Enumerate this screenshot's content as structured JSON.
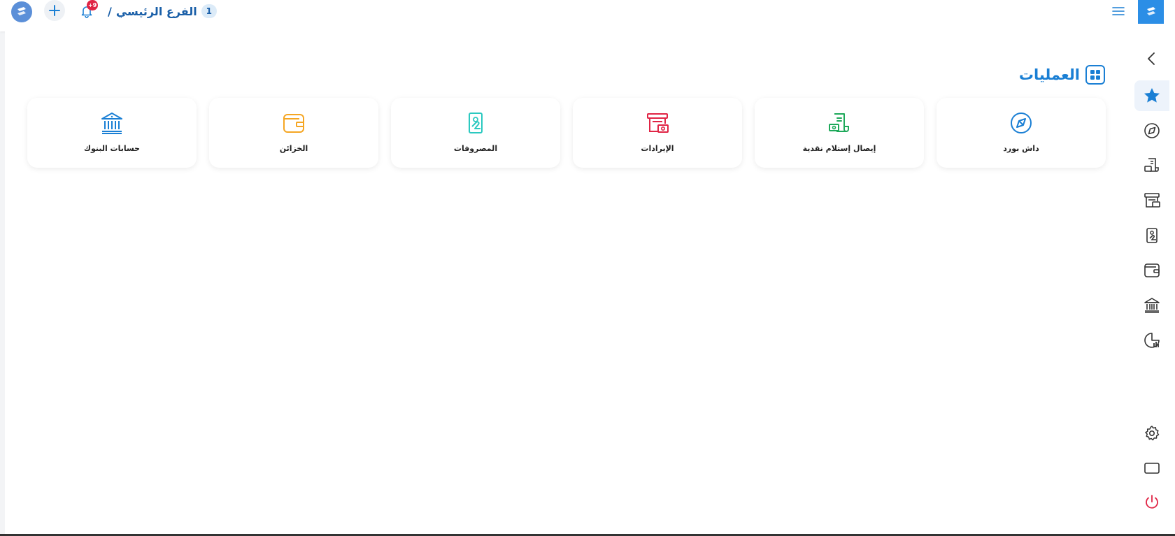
{
  "header": {
    "breadcrumb_branch": "الفرع الرئيسي",
    "breadcrumb_separator": "/",
    "branch_number": "1",
    "notification_badge": "+9",
    "logo_icon": "brand-logo-icon",
    "add_icon": "plus-icon",
    "bell_icon": "bell-icon",
    "menu_icon": "hamburger-menu-icon"
  },
  "section": {
    "title": "العمليات",
    "icon": "grid-icon",
    "accent": "#1a7fd4"
  },
  "cards": [
    {
      "label": "داش بورد",
      "icon": "compass-icon",
      "color": "#1a7fd4"
    },
    {
      "label": "إيصال إستلام نقدية",
      "icon": "cash-receipt-icon",
      "color": "#1ea95a"
    },
    {
      "label": "الإيرادات",
      "icon": "revenue-register-icon",
      "color": "#e02445"
    },
    {
      "label": "المصروفات",
      "icon": "expense-hand-money-icon",
      "color": "#2cc9c0"
    },
    {
      "label": "الخزائن",
      "icon": "wallet-icon",
      "color": "#f5a623"
    },
    {
      "label": "حسابات البنوك",
      "icon": "bank-icon",
      "color": "#1a7fd4"
    }
  ],
  "sidebar": {
    "items": [
      {
        "name": "collapse",
        "icon": "chevron-left-icon"
      },
      {
        "name": "favorites",
        "icon": "star-icon"
      },
      {
        "name": "dashboard",
        "icon": "compass-icon"
      },
      {
        "name": "cash-receipt",
        "icon": "cash-receipt-icon"
      },
      {
        "name": "revenue",
        "icon": "revenue-register-icon"
      },
      {
        "name": "expenses",
        "icon": "expense-hand-money-icon"
      },
      {
        "name": "treasuries",
        "icon": "wallet-icon"
      },
      {
        "name": "banks",
        "icon": "bank-icon"
      },
      {
        "name": "reports",
        "icon": "pie-chart-icon"
      },
      {
        "name": "settings",
        "icon": "gear-icon"
      },
      {
        "name": "fullscreen",
        "icon": "window-icon"
      },
      {
        "name": "logout",
        "icon": "power-icon"
      }
    ],
    "active_color": "#1a7fd4",
    "logout_color": "#e02445"
  }
}
